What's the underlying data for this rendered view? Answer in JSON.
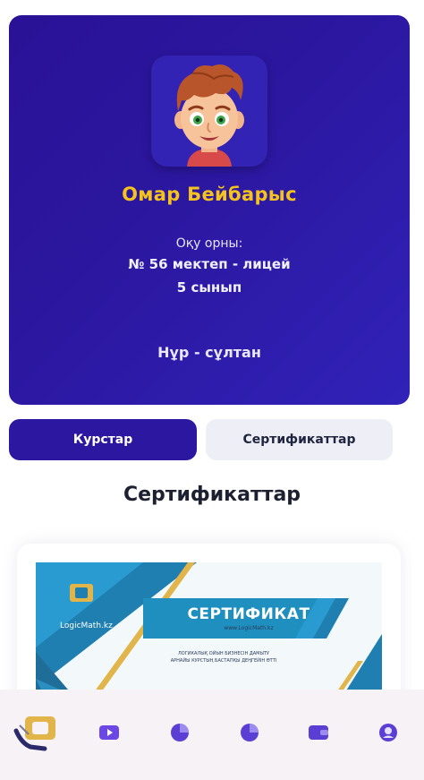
{
  "profile": {
    "name": "Омар Бейбарыс",
    "school_label": "Оқу орны:",
    "school_name": "№ 56 мектеп - лицей",
    "grade": "5 сынып",
    "city": "Нұр - сұлтан",
    "avatar_icon": "boy-avatar-icon"
  },
  "tabs": [
    {
      "label": "Курстар",
      "active": true
    },
    {
      "label": "Сертификаттар",
      "active": false
    }
  ],
  "section_title": "Сертификаттар",
  "certificate": {
    "title": "СЕРТИФИКАТ",
    "site": "www.LogicMath.kz",
    "logo_text": "LogicMath.kz",
    "text_line1": "ЛОГИКАЛЫҚ ОЙЫН БИЗНЕСІН ДАМЫТУ",
    "text_line2": "АРНАЙЫ КУРСТЫҢ БАСТАПҚЫ ДЕҢГЕЙІН ӨТТІ"
  },
  "bottom_nav": {
    "items": [
      "logo-icon",
      "video-icon",
      "pie-chart-icon",
      "pie-chart-alt-icon",
      "wallet-icon",
      "profile-icon"
    ]
  },
  "colors": {
    "primary": "#2b17a0",
    "accent_yellow": "#f5c31b",
    "nav_icon": "#5b3fd4",
    "tab_inactive": "#eeeef6"
  }
}
